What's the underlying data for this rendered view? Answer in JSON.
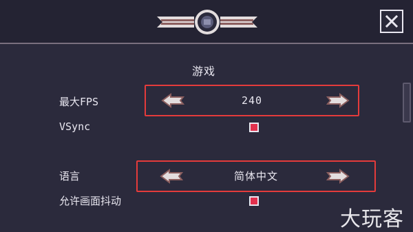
{
  "header": {
    "emblem_icon": "badge-emblem-icon",
    "close_icon": "close-x-icon"
  },
  "section": {
    "title": "游戏"
  },
  "settings": {
    "max_fps": {
      "label": "最大FPS",
      "value": "240",
      "left_icon": "arrow-left-icon",
      "right_icon": "arrow-right-icon"
    },
    "vsync": {
      "label": "VSync",
      "checked": true
    },
    "language": {
      "label": "语言",
      "value": "简体中文",
      "left_icon": "arrow-left-icon",
      "right_icon": "arrow-right-icon"
    },
    "screen_shake": {
      "label": "允许画面抖动",
      "checked": true
    }
  },
  "watermark": {
    "text": "大玩客"
  },
  "colors": {
    "background": "#2b2a3c",
    "header_bg": "#242333",
    "highlight_border": "#e53b3b",
    "checkbox_fill": "#e2304d",
    "text": "#e9e7f0"
  }
}
